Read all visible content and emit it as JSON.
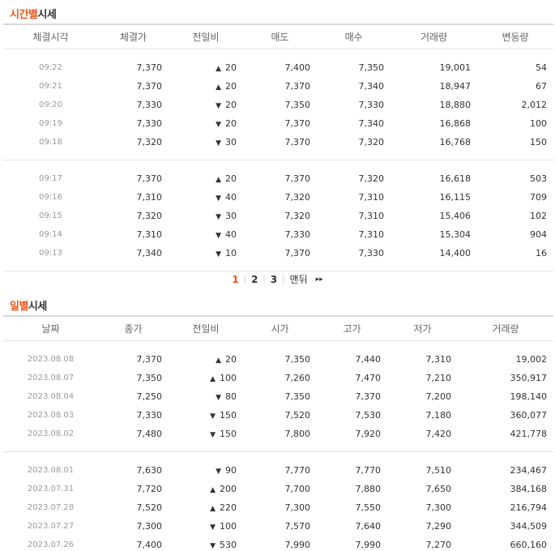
{
  "time_section": {
    "title_accent": "시간별",
    "title_rest": "시세",
    "headers": [
      "체결시각",
      "체결가",
      "전일비",
      "매도",
      "매수",
      "거래량",
      "변동량"
    ],
    "rows": [
      {
        "time": "09:22",
        "price": "7,370",
        "dir": "up",
        "change": "20",
        "ask": "7,400",
        "bid": "7,350",
        "volume": "19,001",
        "delta": "54"
      },
      {
        "time": "09:21",
        "price": "7,370",
        "dir": "up",
        "change": "20",
        "ask": "7,370",
        "bid": "7,340",
        "volume": "18,947",
        "delta": "67"
      },
      {
        "time": "09:20",
        "price": "7,330",
        "dir": "down",
        "change": "20",
        "ask": "7,350",
        "bid": "7,330",
        "volume": "18,880",
        "delta": "2,012"
      },
      {
        "time": "09:19",
        "price": "7,330",
        "dir": "down",
        "change": "20",
        "ask": "7,370",
        "bid": "7,340",
        "volume": "16,868",
        "delta": "100"
      },
      {
        "time": "09:18",
        "price": "7,320",
        "dir": "down",
        "change": "30",
        "ask": "7,370",
        "bid": "7,320",
        "volume": "16,768",
        "delta": "150"
      },
      {
        "time": "09:17",
        "price": "7,370",
        "dir": "up",
        "change": "20",
        "ask": "7,370",
        "bid": "7,320",
        "volume": "16,618",
        "delta": "503"
      },
      {
        "time": "09:16",
        "price": "7,310",
        "dir": "down",
        "change": "40",
        "ask": "7,320",
        "bid": "7,310",
        "volume": "16,115",
        "delta": "709"
      },
      {
        "time": "09:15",
        "price": "7,320",
        "dir": "down",
        "change": "30",
        "ask": "7,320",
        "bid": "7,310",
        "volume": "15,406",
        "delta": "102"
      },
      {
        "time": "09:14",
        "price": "7,310",
        "dir": "down",
        "change": "40",
        "ask": "7,330",
        "bid": "7,310",
        "volume": "15,304",
        "delta": "904"
      },
      {
        "time": "09:13",
        "price": "7,340",
        "dir": "down",
        "change": "10",
        "ask": "7,370",
        "bid": "7,330",
        "volume": "14,400",
        "delta": "16"
      }
    ]
  },
  "pagination": {
    "pages": [
      "1",
      "2",
      "3"
    ],
    "active": "1",
    "last_label": "맨뒤",
    "next_label": "▸▸"
  },
  "daily_section": {
    "title_accent": "일별",
    "title_rest": "시세",
    "headers": [
      "날짜",
      "종가",
      "전일비",
      "시가",
      "고가",
      "저가",
      "거래량"
    ],
    "rows": [
      {
        "date": "2023.08.08",
        "close": "7,370",
        "dir": "up",
        "change": "20",
        "open": "7,350",
        "high": "7,440",
        "low": "7,310",
        "volume": "19,002"
      },
      {
        "date": "2023.08.07",
        "close": "7,350",
        "dir": "up",
        "change": "100",
        "open": "7,260",
        "high": "7,470",
        "low": "7,210",
        "volume": "350,917"
      },
      {
        "date": "2023.08.04",
        "close": "7,250",
        "dir": "down",
        "change": "80",
        "open": "7,350",
        "high": "7,370",
        "low": "7,200",
        "volume": "198,140"
      },
      {
        "date": "2023.08.03",
        "close": "7,330",
        "dir": "down",
        "change": "150",
        "open": "7,520",
        "high": "7,530",
        "low": "7,180",
        "volume": "360,077"
      },
      {
        "date": "2023.08.02",
        "close": "7,480",
        "dir": "down",
        "change": "150",
        "open": "7,800",
        "high": "7,920",
        "low": "7,420",
        "volume": "421,778"
      },
      {
        "date": "2023.08.01",
        "close": "7,630",
        "dir": "down",
        "change": "90",
        "open": "7,770",
        "high": "7,770",
        "low": "7,510",
        "volume": "234,467"
      },
      {
        "date": "2023.07.31",
        "close": "7,720",
        "dir": "up",
        "change": "200",
        "open": "7,700",
        "high": "7,880",
        "low": "7,650",
        "volume": "384,168"
      },
      {
        "date": "2023.07.28",
        "close": "7,520",
        "dir": "up",
        "change": "220",
        "open": "7,300",
        "high": "7,550",
        "low": "7,300",
        "volume": "216,794"
      },
      {
        "date": "2023.07.27",
        "close": "7,300",
        "dir": "down",
        "change": "100",
        "open": "7,570",
        "high": "7,640",
        "low": "7,290",
        "volume": "344,509"
      },
      {
        "date": "2023.07.26",
        "close": "7,400",
        "dir": "down",
        "change": "530",
        "open": "7,990",
        "high": "7,990",
        "low": "7,270",
        "volume": "660,160"
      }
    ]
  }
}
